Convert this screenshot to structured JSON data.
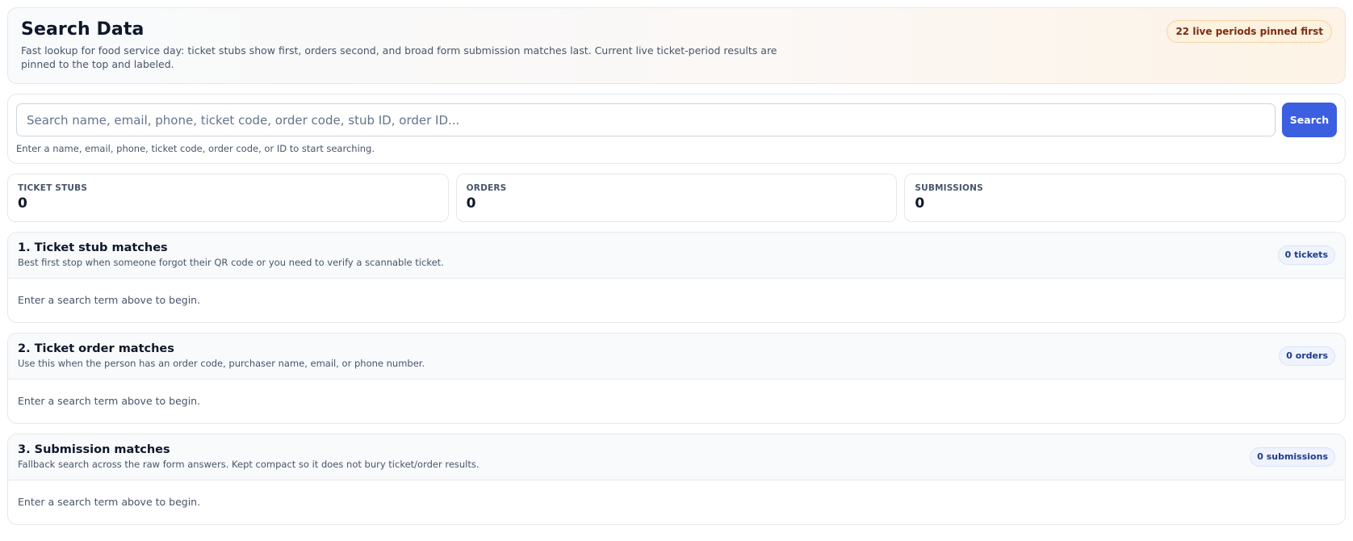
{
  "header": {
    "title": "Search Data",
    "description": "Fast lookup for food service day: ticket stubs show first, orders second, and broad form submission matches last. Current live ticket-period results are pinned to the top and labeled.",
    "badge": "22 live periods pinned first"
  },
  "search": {
    "value": "",
    "placeholder": "Search name, email, phone, ticket code, order code, stub ID, order ID...",
    "button_label": "Search",
    "hint": "Enter a name, email, phone, ticket code, order code, or ID to start searching."
  },
  "stats": [
    {
      "label": "TICKET STUBS",
      "value": "0"
    },
    {
      "label": "ORDERS",
      "value": "0"
    },
    {
      "label": "SUBMISSIONS",
      "value": "0"
    }
  ],
  "sections": [
    {
      "title": "1. Ticket stub matches",
      "description": "Best first stop when someone forgot their QR code or you need to verify a scannable ticket.",
      "badge": "0 tickets",
      "empty_text": "Enter a search term above to begin."
    },
    {
      "title": "2. Ticket order matches",
      "description": "Use this when the person has an order code, purchaser name, email, or phone number.",
      "badge": "0 orders",
      "empty_text": "Enter a search term above to begin."
    },
    {
      "title": "3. Submission matches",
      "description": "Fallback search across the raw form answers. Kept compact so it does not bury ticket/order results.",
      "badge": "0 submissions",
      "empty_text": "Enter a search term above to begin."
    }
  ],
  "colors": {
    "accent": "#3b5fe0",
    "badge_warm_bg": "#fdf1df",
    "badge_warm_text": "#7c2d12",
    "badge_blue_bg": "#eef3fd",
    "badge_blue_text": "#1e3a8a"
  }
}
